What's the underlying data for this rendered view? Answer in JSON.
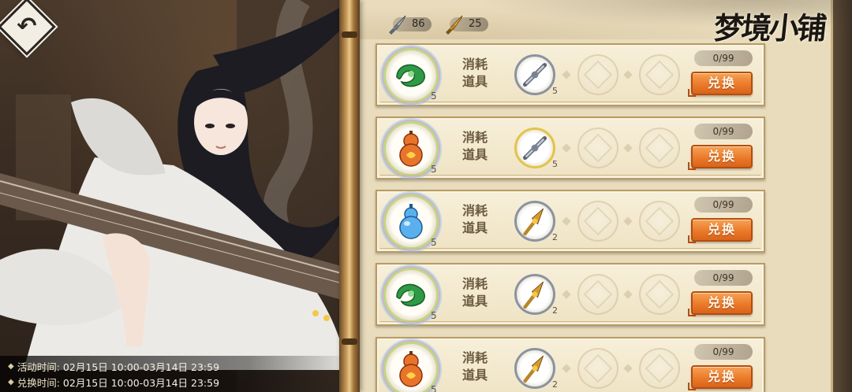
{
  "title": "梦境小铺",
  "currencies": [
    {
      "icon": "dagger-icon",
      "value": "86"
    },
    {
      "icon": "golden-dagger-icon",
      "value": "25"
    }
  ],
  "activity_time_label": "活动时间:",
  "activity_time_value": "02月15日 10:00-03月14日 23:59",
  "exchange_time_label": "兑换时间:",
  "exchange_time_value": "02月15日 10:00-03月14日 23:59",
  "rows": [
    {
      "reward_icon": "green-jade-icon",
      "reward_count": "5",
      "category": "消耗道具",
      "cost_icon": "dagger-icon",
      "cost_count": "5",
      "stock": "0/99",
      "button": "兑换"
    },
    {
      "reward_icon": "gourd-icon",
      "reward_count": "5",
      "category": "消耗道具",
      "cost_icon": "dagger-icon",
      "cost_count": "5",
      "stock": "0/99",
      "button": "兑换"
    },
    {
      "reward_icon": "blue-gourd-icon",
      "reward_count": "5",
      "category": "消耗道具",
      "cost_icon": "golden-dagger-icon",
      "cost_count": "2",
      "stock": "0/99",
      "button": "兑换"
    },
    {
      "reward_icon": "green-jade-icon",
      "reward_count": "5",
      "category": "消耗道具",
      "cost_icon": "golden-dagger-icon",
      "cost_count": "2",
      "stock": "0/99",
      "button": "兑换"
    },
    {
      "reward_icon": "gourd-icon",
      "reward_count": "5",
      "category": "消耗道具",
      "cost_icon": "golden-dagger-icon",
      "cost_count": "2",
      "stock": "0/99",
      "button": "兑换"
    }
  ],
  "colors": {
    "button": "#ec7a2a",
    "parchment": "#efe3c4",
    "frame": "#b89b63"
  }
}
